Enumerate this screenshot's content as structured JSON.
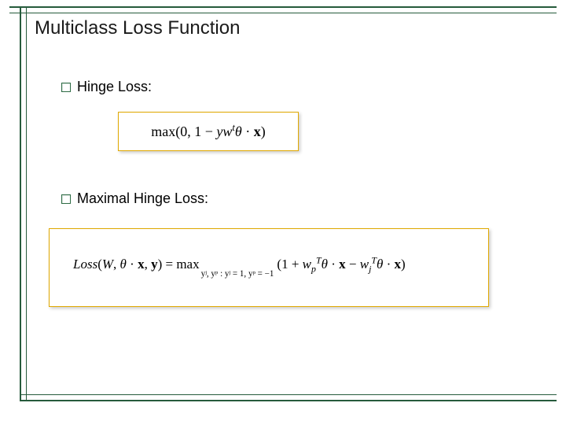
{
  "title": "Multiclass Loss Function",
  "bullets": {
    "hinge_label": "Hinge Loss:",
    "maximal_label": "Maximal Hinge Loss:"
  },
  "formulas": {
    "hinge": {
      "prefix": "max(0, 1 − ",
      "y": "y",
      "w": "w",
      "t_sup": "t",
      "theta": "θ",
      "dot1": " · ",
      "x": "x",
      "suffix": ")"
    },
    "maximal": {
      "loss_head": "Loss",
      "open": "(",
      "W": "W",
      "comma1": ", ",
      "theta": "θ",
      "dot1": " · ",
      "x": "x",
      "comma2": ", ",
      "y": "y",
      "close_eq": ") = ",
      "max_op": "max",
      "sub_line1": "yʲ, yᵖ : yʲ = 1, yᵖ = −1",
      "open2": "(1 + ",
      "w1": "w",
      "p_sub": "p",
      "T_sup": "T",
      "theta2": "θ",
      "dot2": " · ",
      "x2": "x",
      "minus": " − ",
      "w2": "w",
      "j_sub": "j",
      "T_sup2": "T",
      "theta3": "θ",
      "dot3": " · ",
      "x3": "x",
      "close2": ")"
    }
  }
}
